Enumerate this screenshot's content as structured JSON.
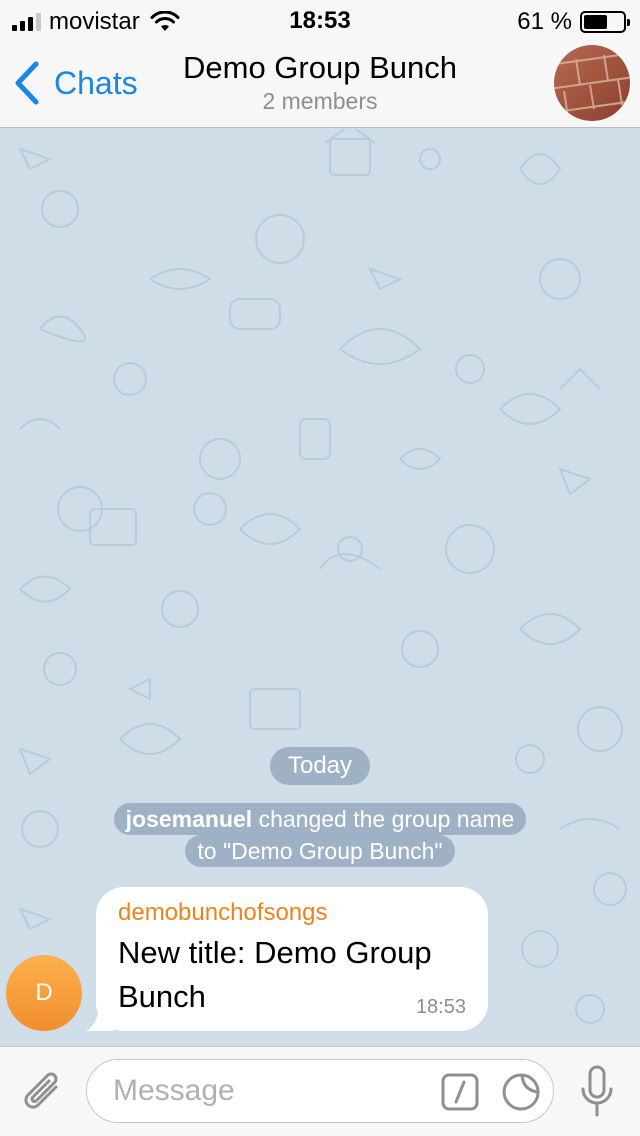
{
  "status_bar": {
    "carrier": "movistar",
    "time": "18:53",
    "battery_percent": "61 %",
    "battery_level": 0.61,
    "signal_icon": "cellular-signal-icon",
    "wifi_icon": "wifi-icon",
    "battery_icon": "battery-icon"
  },
  "nav": {
    "back_label": "Chats",
    "back_icon": "chevron-left-icon",
    "title": "Demo Group Bunch",
    "subtitle": "2 members"
  },
  "chat": {
    "date_separator": "Today",
    "service_message": {
      "actor": "josemanuel",
      "text_line1": "changed the group name",
      "text_line2": "to \"Demo Group Bunch\""
    },
    "messages": [
      {
        "sender": "demobunchofsongs",
        "avatar_initial": "D",
        "text": "New title: Demo Group Bunch",
        "time": "18:53"
      }
    ]
  },
  "input": {
    "placeholder": "Message",
    "attach_icon": "paperclip-icon",
    "command_icon": "slash-command-icon",
    "sticker_icon": "sticker-icon",
    "mic_icon": "microphone-icon"
  },
  "colors": {
    "accent": "#1a87e6",
    "sender_name": "#f0821e",
    "chat_background": "#cfdde9",
    "avatar_orange": "#f6a23c"
  }
}
